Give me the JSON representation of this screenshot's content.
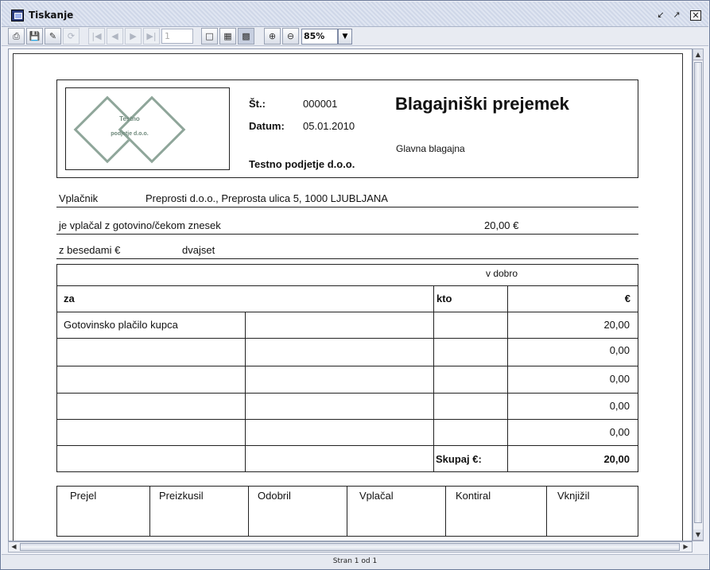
{
  "window": {
    "title": "Tiskanje"
  },
  "toolbar": {
    "page_value": "1",
    "zoom": "85%",
    "buttons": [
      "print-icon",
      "save-icon",
      "edit-icon",
      "reload-icon",
      "first-page-icon",
      "prev-page-icon",
      "next-page-icon",
      "last-page-icon",
      "single-page-icon",
      "fit-width-icon",
      "fit-page-icon",
      "zoom-in-icon",
      "zoom-out-icon"
    ]
  },
  "status": {
    "text": "Stran 1 od 1"
  },
  "logo": {
    "line1": "Testno",
    "line2": "podjetje d.o.o."
  },
  "header": {
    "st_label": "Št.:",
    "st_value": "000001",
    "datum_label": "Datum:",
    "datum_value": "05.01.2010",
    "company": "Testno podjetje d.o.o.",
    "doc_title": "Blagajniški prejemek",
    "cashbox": "Glavna blagajna"
  },
  "payer": {
    "label": "Vplačnik",
    "value": "Preprosti d.o.o., Preprosta ulica 5, 1000 LJUBLJANA",
    "paid_label": "je vplačal z gotovino/čekom znesek",
    "paid_value": "20,00 €",
    "words_label": "z besedami €",
    "words_value": "dvajset"
  },
  "table": {
    "credit_label": "v dobro",
    "col_za": "za",
    "col_kto": "kto",
    "col_eur": "€",
    "rows": [
      {
        "za": "Gotovinsko plačilo kupca",
        "amount": "20,00"
      },
      {
        "za": "",
        "amount": "0,00"
      },
      {
        "za": "",
        "amount": "0,00"
      },
      {
        "za": "",
        "amount": "0,00"
      },
      {
        "za": "",
        "amount": "0,00"
      }
    ],
    "total_label": "Skupaj €:",
    "total_value": "20,00"
  },
  "signatures": [
    "Prejel",
    "Preizkusil",
    "Odobril",
    "Vplačal",
    "Kontiral",
    "Vknjižil"
  ]
}
